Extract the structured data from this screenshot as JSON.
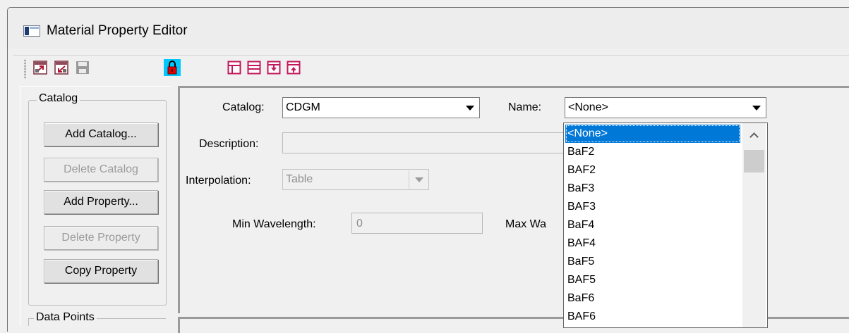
{
  "window": {
    "title": "Material Property Editor"
  },
  "toolbar": {
    "buttons": [
      {
        "name": "import-icon"
      },
      {
        "name": "export-icon"
      },
      {
        "name": "save-icon"
      },
      {
        "name": "lock-icon"
      },
      {
        "name": "layout-left-icon"
      },
      {
        "name": "layout-split-icon"
      },
      {
        "name": "move-down-icon"
      },
      {
        "name": "move-up-icon"
      }
    ]
  },
  "catalog_group": {
    "label": "Catalog",
    "buttons": {
      "add_catalog": "Add Catalog...",
      "delete_catalog": "Delete Catalog",
      "add_property": "Add Property...",
      "delete_property": "Delete Property",
      "copy_property": "Copy Property"
    }
  },
  "data_points_group": {
    "label": "Data Points"
  },
  "form": {
    "catalog_label": "Catalog:",
    "catalog_value": "CDGM",
    "name_label": "Name:",
    "name_value": "<None>",
    "description_label": "Description:",
    "description_value": "",
    "interpolation_label": "Interpolation:",
    "interpolation_value": "Table",
    "min_wavelength_label": "Min Wavelength:",
    "min_wavelength_value": "0",
    "max_wavelength_label": "Max Wa"
  },
  "name_dropdown": {
    "items": [
      "<None>",
      "BaF2",
      "BAF2",
      "BaF3",
      "BAF3",
      "BaF4",
      "BAF4",
      "BaF5",
      "BAF5",
      "BaF6",
      "BAF6"
    ],
    "selected": "<None>"
  },
  "colors": {
    "selection": "#0078d7",
    "toolbar_icon": "#c2185b",
    "lock_bg": "#00c8ff",
    "lock_body": "#e00000"
  }
}
